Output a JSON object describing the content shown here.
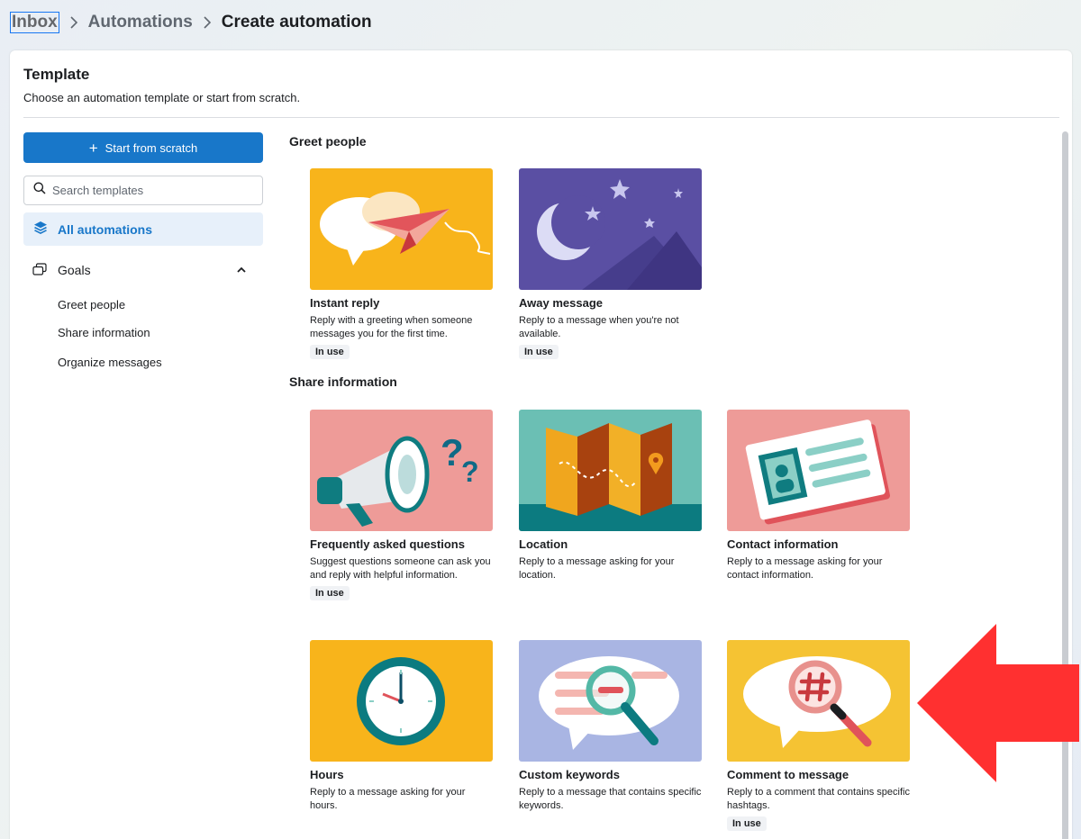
{
  "breadcrumb": {
    "inbox": "Inbox",
    "automations": "Automations",
    "current": "Create automation"
  },
  "card": {
    "title": "Template",
    "subtitle": "Choose an automation template or start from scratch."
  },
  "sidebar": {
    "start_button": "Start from scratch",
    "search_placeholder": "Search templates",
    "all_automations": "All automations",
    "goals": "Goals",
    "goal_items": [
      "Greet people",
      "Share information",
      "Organize messages"
    ]
  },
  "sections": {
    "greet": "Greet people",
    "share": "Share information"
  },
  "templates": [
    {
      "name": "Instant reply",
      "desc": "Reply with a greeting when someone messages you for the first time.",
      "badge": "In use"
    },
    {
      "name": "Away message",
      "desc": "Reply to a message when you're not available.",
      "badge": "In use"
    },
    {
      "name": "Frequently asked questions",
      "desc": "Suggest questions someone can ask you and reply with helpful information.",
      "badge": "In use"
    },
    {
      "name": "Location",
      "desc": "Reply to a message asking for your location."
    },
    {
      "name": "Contact information",
      "desc": "Reply to a message asking for your contact information."
    },
    {
      "name": "Hours",
      "desc": "Reply to a message asking for your hours."
    },
    {
      "name": "Custom keywords",
      "desc": "Reply to a message that contains specific keywords."
    },
    {
      "name": "Comment to message",
      "desc": "Reply to a comment that contains specific hashtags.",
      "badge": "In use"
    }
  ],
  "colors": {
    "accent": "#1877c9",
    "annotation_arrow": "#ff3030"
  }
}
